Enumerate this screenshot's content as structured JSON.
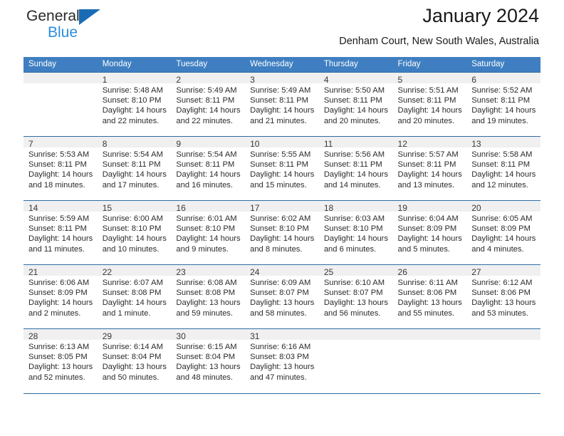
{
  "brand": {
    "name_part1": "General",
    "name_part2": "Blue",
    "triangle_color": "#1a6bb5",
    "blue_color": "#2b8ede"
  },
  "header": {
    "title": "January 2024",
    "subtitle": "Denham Court, New South Wales, Australia",
    "header_bg": "#3f7fc1",
    "row_rule_color": "#2e6da4",
    "daynum_bg": "#f0f0f0"
  },
  "weekdays": [
    "Sunday",
    "Monday",
    "Tuesday",
    "Wednesday",
    "Thursday",
    "Friday",
    "Saturday"
  ],
  "weeks": [
    [
      {
        "day": "",
        "lines": []
      },
      {
        "day": "1",
        "lines": [
          "Sunrise: 5:48 AM",
          "Sunset: 8:10 PM",
          "Daylight: 14 hours",
          "and 22 minutes."
        ]
      },
      {
        "day": "2",
        "lines": [
          "Sunrise: 5:49 AM",
          "Sunset: 8:11 PM",
          "Daylight: 14 hours",
          "and 22 minutes."
        ]
      },
      {
        "day": "3",
        "lines": [
          "Sunrise: 5:49 AM",
          "Sunset: 8:11 PM",
          "Daylight: 14 hours",
          "and 21 minutes."
        ]
      },
      {
        "day": "4",
        "lines": [
          "Sunrise: 5:50 AM",
          "Sunset: 8:11 PM",
          "Daylight: 14 hours",
          "and 20 minutes."
        ]
      },
      {
        "day": "5",
        "lines": [
          "Sunrise: 5:51 AM",
          "Sunset: 8:11 PM",
          "Daylight: 14 hours",
          "and 20 minutes."
        ]
      },
      {
        "day": "6",
        "lines": [
          "Sunrise: 5:52 AM",
          "Sunset: 8:11 PM",
          "Daylight: 14 hours",
          "and 19 minutes."
        ]
      }
    ],
    [
      {
        "day": "7",
        "lines": [
          "Sunrise: 5:53 AM",
          "Sunset: 8:11 PM",
          "Daylight: 14 hours",
          "and 18 minutes."
        ]
      },
      {
        "day": "8",
        "lines": [
          "Sunrise: 5:54 AM",
          "Sunset: 8:11 PM",
          "Daylight: 14 hours",
          "and 17 minutes."
        ]
      },
      {
        "day": "9",
        "lines": [
          "Sunrise: 5:54 AM",
          "Sunset: 8:11 PM",
          "Daylight: 14 hours",
          "and 16 minutes."
        ]
      },
      {
        "day": "10",
        "lines": [
          "Sunrise: 5:55 AM",
          "Sunset: 8:11 PM",
          "Daylight: 14 hours",
          "and 15 minutes."
        ]
      },
      {
        "day": "11",
        "lines": [
          "Sunrise: 5:56 AM",
          "Sunset: 8:11 PM",
          "Daylight: 14 hours",
          "and 14 minutes."
        ]
      },
      {
        "day": "12",
        "lines": [
          "Sunrise: 5:57 AM",
          "Sunset: 8:11 PM",
          "Daylight: 14 hours",
          "and 13 minutes."
        ]
      },
      {
        "day": "13",
        "lines": [
          "Sunrise: 5:58 AM",
          "Sunset: 8:11 PM",
          "Daylight: 14 hours",
          "and 12 minutes."
        ]
      }
    ],
    [
      {
        "day": "14",
        "lines": [
          "Sunrise: 5:59 AM",
          "Sunset: 8:11 PM",
          "Daylight: 14 hours",
          "and 11 minutes."
        ]
      },
      {
        "day": "15",
        "lines": [
          "Sunrise: 6:00 AM",
          "Sunset: 8:10 PM",
          "Daylight: 14 hours",
          "and 10 minutes."
        ]
      },
      {
        "day": "16",
        "lines": [
          "Sunrise: 6:01 AM",
          "Sunset: 8:10 PM",
          "Daylight: 14 hours",
          "and 9 minutes."
        ]
      },
      {
        "day": "17",
        "lines": [
          "Sunrise: 6:02 AM",
          "Sunset: 8:10 PM",
          "Daylight: 14 hours",
          "and 8 minutes."
        ]
      },
      {
        "day": "18",
        "lines": [
          "Sunrise: 6:03 AM",
          "Sunset: 8:10 PM",
          "Daylight: 14 hours",
          "and 6 minutes."
        ]
      },
      {
        "day": "19",
        "lines": [
          "Sunrise: 6:04 AM",
          "Sunset: 8:09 PM",
          "Daylight: 14 hours",
          "and 5 minutes."
        ]
      },
      {
        "day": "20",
        "lines": [
          "Sunrise: 6:05 AM",
          "Sunset: 8:09 PM",
          "Daylight: 14 hours",
          "and 4 minutes."
        ]
      }
    ],
    [
      {
        "day": "21",
        "lines": [
          "Sunrise: 6:06 AM",
          "Sunset: 8:09 PM",
          "Daylight: 14 hours",
          "and 2 minutes."
        ]
      },
      {
        "day": "22",
        "lines": [
          "Sunrise: 6:07 AM",
          "Sunset: 8:08 PM",
          "Daylight: 14 hours",
          "and 1 minute."
        ]
      },
      {
        "day": "23",
        "lines": [
          "Sunrise: 6:08 AM",
          "Sunset: 8:08 PM",
          "Daylight: 13 hours",
          "and 59 minutes."
        ]
      },
      {
        "day": "24",
        "lines": [
          "Sunrise: 6:09 AM",
          "Sunset: 8:07 PM",
          "Daylight: 13 hours",
          "and 58 minutes."
        ]
      },
      {
        "day": "25",
        "lines": [
          "Sunrise: 6:10 AM",
          "Sunset: 8:07 PM",
          "Daylight: 13 hours",
          "and 56 minutes."
        ]
      },
      {
        "day": "26",
        "lines": [
          "Sunrise: 6:11 AM",
          "Sunset: 8:06 PM",
          "Daylight: 13 hours",
          "and 55 minutes."
        ]
      },
      {
        "day": "27",
        "lines": [
          "Sunrise: 6:12 AM",
          "Sunset: 8:06 PM",
          "Daylight: 13 hours",
          "and 53 minutes."
        ]
      }
    ],
    [
      {
        "day": "28",
        "lines": [
          "Sunrise: 6:13 AM",
          "Sunset: 8:05 PM",
          "Daylight: 13 hours",
          "and 52 minutes."
        ]
      },
      {
        "day": "29",
        "lines": [
          "Sunrise: 6:14 AM",
          "Sunset: 8:04 PM",
          "Daylight: 13 hours",
          "and 50 minutes."
        ]
      },
      {
        "day": "30",
        "lines": [
          "Sunrise: 6:15 AM",
          "Sunset: 8:04 PM",
          "Daylight: 13 hours",
          "and 48 minutes."
        ]
      },
      {
        "day": "31",
        "lines": [
          "Sunrise: 6:16 AM",
          "Sunset: 8:03 PM",
          "Daylight: 13 hours",
          "and 47 minutes."
        ]
      },
      {
        "day": "",
        "lines": []
      },
      {
        "day": "",
        "lines": []
      },
      {
        "day": "",
        "lines": []
      }
    ]
  ]
}
